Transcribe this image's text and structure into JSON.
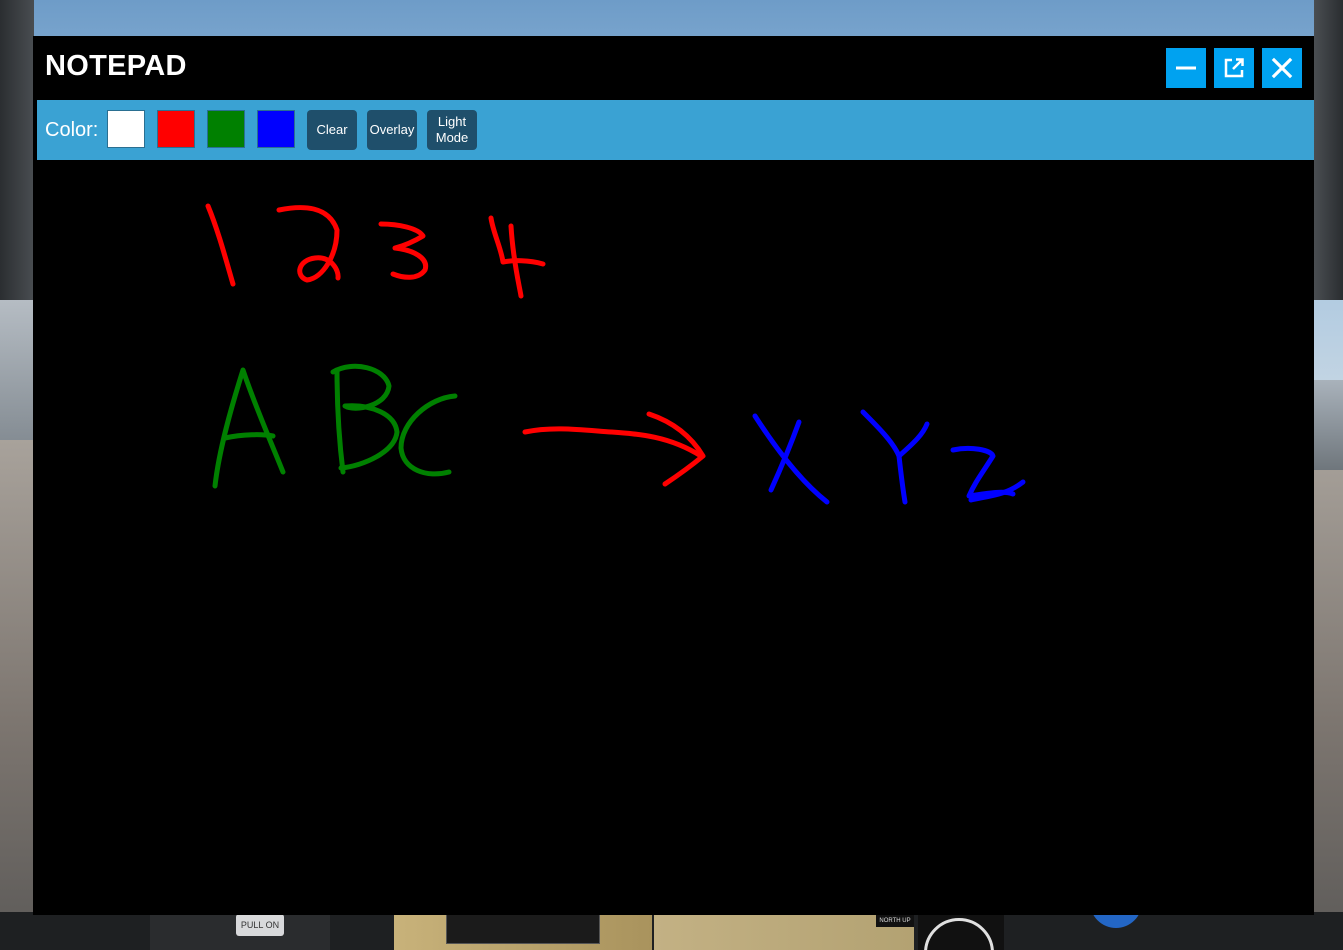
{
  "scene": {
    "dash_pull_label": "PULL ON",
    "map_label": "NORTH UP"
  },
  "window": {
    "title": "NOTEPAD",
    "buttons": [
      {
        "name": "minimize",
        "icon": "minimize-icon"
      },
      {
        "name": "pop-out",
        "icon": "external-window-icon"
      },
      {
        "name": "close",
        "icon": "close-icon"
      }
    ],
    "accent_color": "#00a2f0"
  },
  "toolbar": {
    "color_label": "Color:",
    "swatches": [
      {
        "name": "white",
        "hex": "#ffffff"
      },
      {
        "name": "red",
        "hex": "#ff0000"
      },
      {
        "name": "green",
        "hex": "#008000"
      },
      {
        "name": "blue",
        "hex": "#0000ff"
      }
    ],
    "clear_label": "Clear",
    "overlay_label": "Overlay",
    "light_mode_label": "Light\nMode",
    "background_color": "#3aa2d3"
  },
  "canvas": {
    "background": "#000000",
    "strokes": [
      {
        "color": "#ff0000",
        "text": "1234"
      },
      {
        "color": "#008000",
        "text": "ABC"
      },
      {
        "color": "#ff0000",
        "text": "arrow"
      },
      {
        "color": "#0000ff",
        "text": "XYZ"
      }
    ]
  }
}
